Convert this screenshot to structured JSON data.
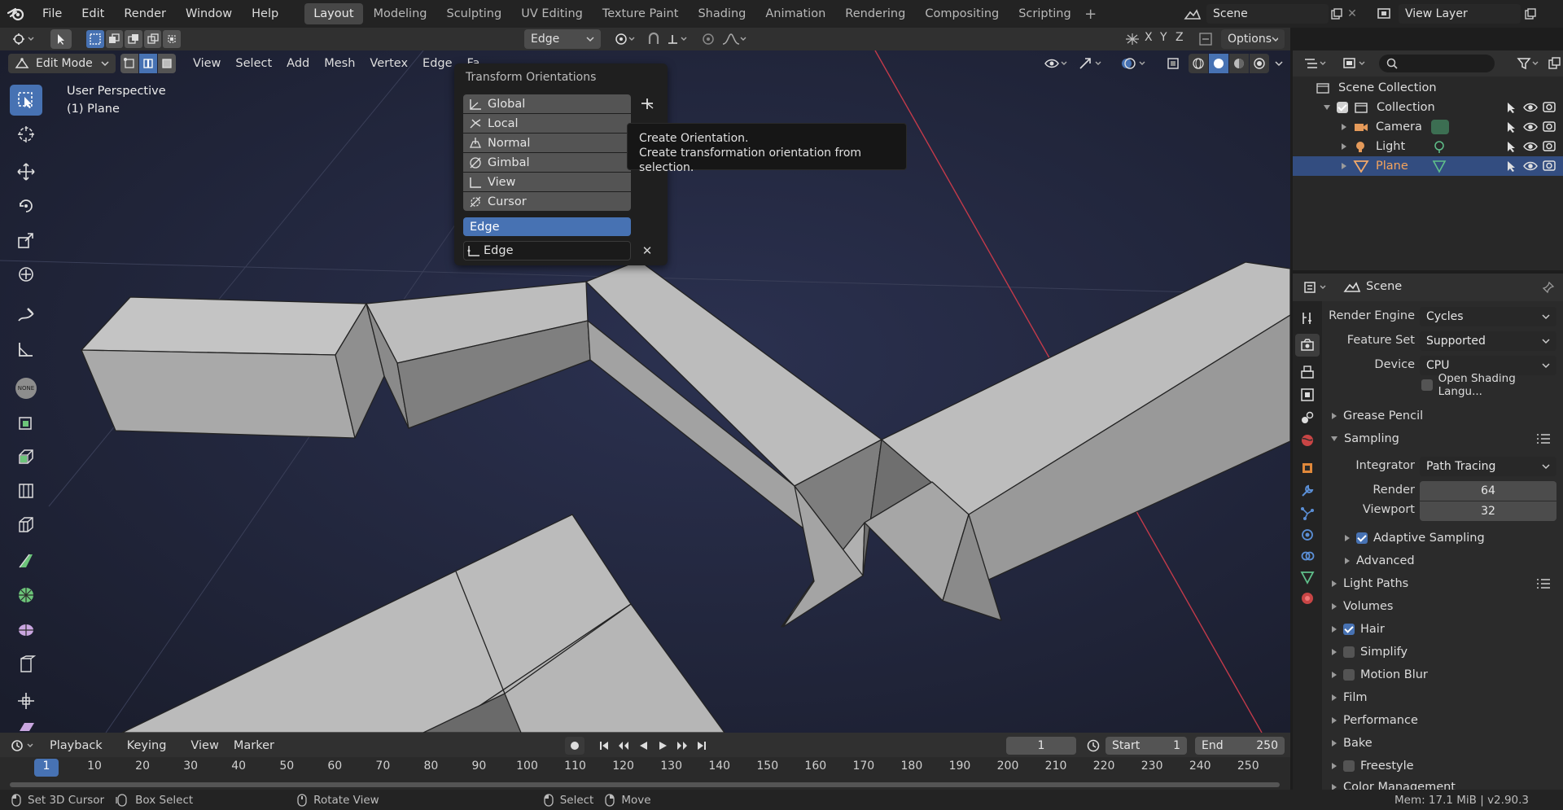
{
  "top_menu": {
    "items": [
      "File",
      "Edit",
      "Render",
      "Window",
      "Help"
    ],
    "workspaces": [
      "Layout",
      "Modeling",
      "Sculpting",
      "UV Editing",
      "Texture Paint",
      "Shading",
      "Animation",
      "Rendering",
      "Compositing",
      "Scripting"
    ],
    "active_workspace": "Layout",
    "scene_name": "Scene",
    "view_layer": "View Layer",
    "add_workspace_icon": "plus-icon"
  },
  "tool_header": {
    "orientation_value": "Edge",
    "axes": [
      "X",
      "Y",
      "Z"
    ],
    "options_label": "Options"
  },
  "viewport_header": {
    "mode": "Edit Mode",
    "menus": [
      "View",
      "Select",
      "Add",
      "Mesh",
      "Vertex",
      "Edge",
      "Fa"
    ]
  },
  "viewport": {
    "perspective_label": "User Perspective",
    "object_label": "(1) Plane"
  },
  "orientation_popup": {
    "title": "Transform Orientations",
    "items": [
      "Global",
      "Local",
      "Normal",
      "Gimbal",
      "View",
      "Cursor"
    ],
    "selected": "Edge",
    "custom_name": "Edge"
  },
  "tooltip": {
    "title": "Create Orientation.",
    "description": "Create transformation orientation from selection."
  },
  "outliner": {
    "root": "Scene Collection",
    "collection": "Collection",
    "objects": [
      "Camera",
      "Light",
      "Plane"
    ],
    "selected": "Plane"
  },
  "properties": {
    "context": "Scene",
    "render_engine_label": "Render Engine",
    "render_engine": "Cycles",
    "feature_set_label": "Feature Set",
    "feature_set": "Supported",
    "device_label": "Device",
    "device": "CPU",
    "osl_label": "Open Shading Langu...",
    "panels": {
      "grease_pencil": "Grease Pencil",
      "sampling": "Sampling",
      "integrator_label": "Integrator",
      "integrator": "Path Tracing",
      "render_label": "Render",
      "render_samples": "64",
      "viewport_label": "Viewport",
      "viewport_samples": "32",
      "adaptive": "Adaptive Sampling",
      "advanced": "Advanced",
      "light_paths": "Light Paths",
      "volumes": "Volumes",
      "hair": "Hair",
      "simplify": "Simplify",
      "motion_blur": "Motion Blur",
      "film": "Film",
      "performance": "Performance",
      "bake": "Bake",
      "freestyle": "Freestyle",
      "color_management": "Color Management"
    },
    "checks": {
      "osl": false,
      "adaptive": true,
      "hair": true,
      "simplify": false,
      "motion_blur": false,
      "freestyle": false
    }
  },
  "timeline": {
    "menus": [
      "Playback",
      "Keying",
      "View",
      "Marker"
    ],
    "current_frame": "1",
    "start_label": "Start",
    "start": "1",
    "end_label": "End",
    "end": "250",
    "ruler": [
      "1",
      "10",
      "20",
      "30",
      "40",
      "50",
      "60",
      "70",
      "80",
      "90",
      "100",
      "110",
      "120",
      "130",
      "140",
      "150",
      "160",
      "170",
      "180",
      "190",
      "200",
      "210",
      "220",
      "230",
      "240",
      "250"
    ]
  },
  "statusbar": {
    "set_cursor": "Set 3D Cursor",
    "box_select": "Box Select",
    "rotate_view": "Rotate View",
    "select": "Select",
    "move": "Move",
    "stats": "Mem: 17.1 MiB | v2.90.3"
  },
  "colors": {
    "accent": "#4772b3",
    "mesh_face": "#b9b9b9",
    "x_axis": "#d2394b",
    "viewport_bg": "#272c44"
  }
}
